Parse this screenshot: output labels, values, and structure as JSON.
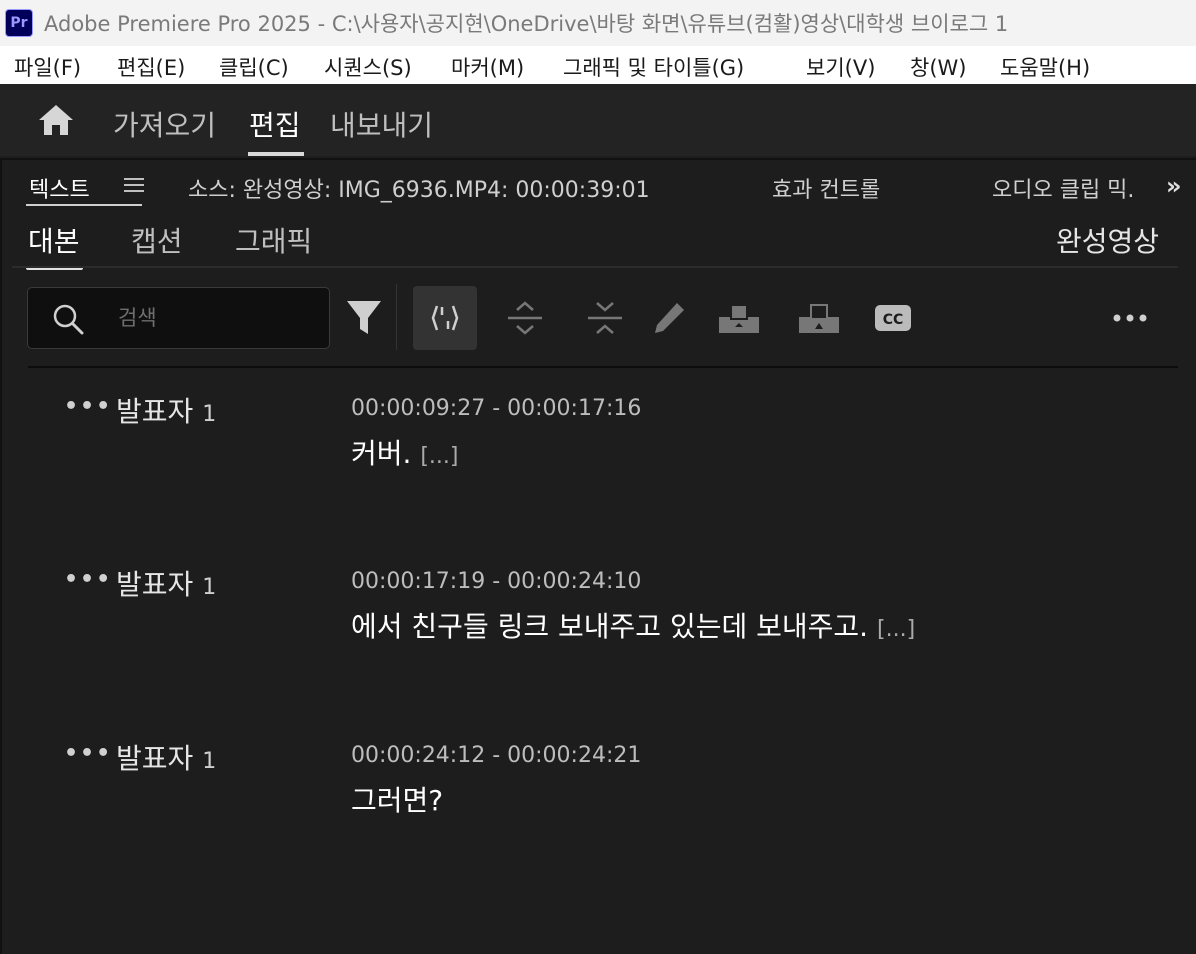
{
  "titlebar": {
    "app_badge": "Pr",
    "title": "Adobe Premiere Pro 2025 - C:\\사용자\\공지현\\OneDrive\\바탕 화면\\유튜브(컴활)영상\\대학생 브이로그 1"
  },
  "menubar": {
    "items": [
      "파일(F)",
      "편집(E)",
      "클립(C)",
      "시퀀스(S)",
      "마커(M)",
      "그래픽 및 타이틀(G)",
      "보기(V)",
      "창(W)",
      "도움말(H)"
    ]
  },
  "workspace": {
    "home_icon": "home-icon",
    "tabs": [
      "가져오기",
      "편집",
      "내보내기"
    ],
    "active_tab": "편집"
  },
  "panel": {
    "tabs": [
      "텍스트",
      "소스: 완성영상: IMG_6936.MP4: 00:00:39:01",
      "효과 컨트롤",
      "오디오 클립 믹."
    ],
    "active_tab": "텍스트",
    "overflow_icon": "double-chevron-right-icon",
    "menu_icon": "hamburger-menu-icon",
    "sub_tabs": [
      "대본",
      "캡션",
      "그래픽"
    ],
    "active_sub_tab": "대본",
    "sequence_name": "완성영상"
  },
  "toolbar": {
    "search_placeholder": "검색",
    "search_value": "",
    "icons": [
      "filter-icon",
      "split-segment-icon",
      "expand-icon",
      "collapse-icon",
      "pencil-icon",
      "insert-icon",
      "overwrite-icon",
      "cc-icon",
      "more-icon"
    ],
    "selected_tool": "split-segment-icon"
  },
  "transcript": {
    "entries": [
      {
        "speaker": "발표자",
        "speaker_num": "1",
        "timecode": "00:00:09:27 - 00:00:17:16",
        "text": "커버.",
        "suffix": "[...]"
      },
      {
        "speaker": "발표자",
        "speaker_num": "1",
        "timecode": "00:00:17:19 - 00:00:24:10",
        "text": "에서 친구들 링크 보내주고 있는데 보내주고.",
        "suffix": "[...]"
      },
      {
        "speaker": "발표자",
        "speaker_num": "1",
        "timecode": "00:00:24:12 - 00:00:24:21",
        "text": "그러면?",
        "suffix": ""
      }
    ]
  }
}
